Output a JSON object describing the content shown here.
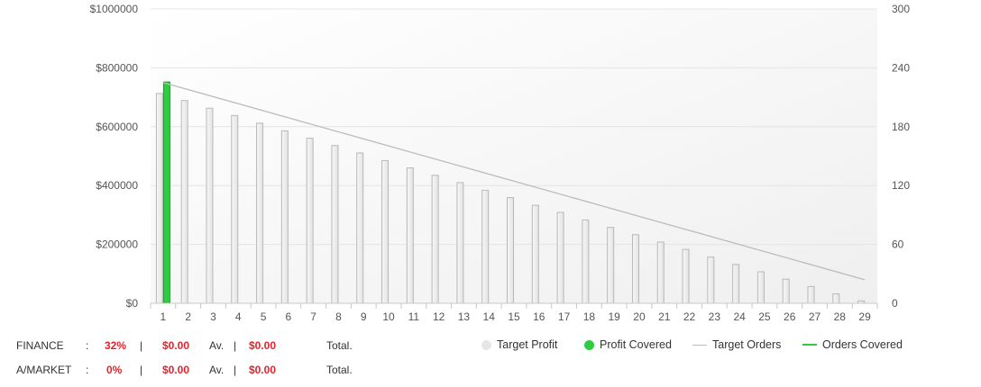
{
  "chart_data": {
    "type": "bar",
    "categories": [
      "1",
      "2",
      "3",
      "4",
      "5",
      "6",
      "7",
      "8",
      "9",
      "10",
      "11",
      "12",
      "13",
      "14",
      "15",
      "16",
      "17",
      "18",
      "19",
      "20",
      "21",
      "22",
      "23",
      "24",
      "25",
      "26",
      "27",
      "28",
      "29"
    ],
    "series": [
      {
        "name": "Target Profit",
        "type": "bar",
        "axis": "left",
        "color": "#eeeeee",
        "values": [
          713000,
          689000,
          663000,
          638000,
          612000,
          586000,
          561000,
          536000,
          511000,
          485000,
          460000,
          435000,
          410000,
          384000,
          359000,
          333000,
          309000,
          283000,
          258000,
          233000,
          208000,
          183000,
          157000,
          132000,
          107000,
          82000,
          57000,
          32000,
          8000
        ]
      },
      {
        "name": "Profit Covered",
        "type": "bar",
        "axis": "left",
        "color": "#2ecc40",
        "values": [
          752000,
          null,
          null,
          null,
          null,
          null,
          null,
          null,
          null,
          null,
          null,
          null,
          null,
          null,
          null,
          null,
          null,
          null,
          null,
          null,
          null,
          null,
          null,
          null,
          null,
          null,
          null,
          null,
          null
        ]
      },
      {
        "name": "Target Orders",
        "type": "line",
        "axis": "right",
        "color": "#bbbbbb",
        "x_start": "1",
        "x_end": "29",
        "values_endpoints": [
          225,
          24
        ]
      },
      {
        "name": "Orders Covered",
        "type": "line",
        "axis": "right",
        "color": "#2ecc40",
        "values": []
      }
    ],
    "y_left": {
      "min": 0,
      "max": 1000000,
      "ticks": [
        "$1000000",
        "$800000",
        "$600000",
        "$400000",
        "$200000",
        "$0"
      ]
    },
    "y_right": {
      "min": 0,
      "max": 300,
      "ticks": [
        "300",
        "240",
        "180",
        "120",
        "60",
        "0"
      ]
    },
    "grid": true,
    "legend_position": "bottom-right"
  },
  "legend": {
    "target_profit": "Target Profit",
    "profit_covered": "Profit Covered",
    "target_orders": "Target Orders",
    "orders_covered": "Orders Covered"
  },
  "summary": [
    {
      "name": "FINANCE",
      "sep": ":",
      "percent": "32%",
      "pipe1": "|",
      "amount1": "$0.00",
      "av": "Av.",
      "pipe2": "|",
      "amount2": "$0.00",
      "total": "Total."
    },
    {
      "name": "A/MARKET",
      "sep": ":",
      "percent": "0%",
      "pipe1": "|",
      "amount1": "$0.00",
      "av": "Av.",
      "pipe2": "|",
      "amount2": "$0.00",
      "total": "Total."
    }
  ],
  "colors": {
    "profit_covered": "#2ecc40",
    "target_profit": "#eeeeee",
    "target_orders": "#bbbbbb",
    "red_text": "#e8212a"
  }
}
